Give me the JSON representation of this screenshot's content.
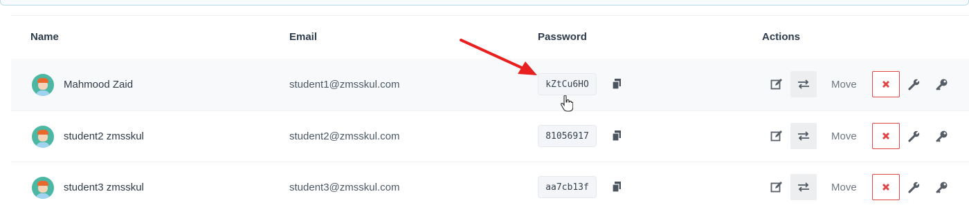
{
  "table": {
    "headers": {
      "name": "Name",
      "email": "Email",
      "password": "Password",
      "actions": "Actions"
    },
    "rows": [
      {
        "name": "Mahmood Zaid",
        "email": "student1@zmsskul.com",
        "password": "kZtCu6HO",
        "move_label": "Move"
      },
      {
        "name": "student2 zmsskul",
        "email": "student2@zmsskul.com",
        "password": "81056917",
        "move_label": "Move"
      },
      {
        "name": "student3 zmsskul",
        "email": "student3@zmsskul.com",
        "password": "aa7cb13f",
        "move_label": "Move"
      }
    ]
  },
  "colors": {
    "delete_accent": "#e24545",
    "annotation_arrow": "#e8201f",
    "avatar_bg": "#4cb8a4"
  }
}
